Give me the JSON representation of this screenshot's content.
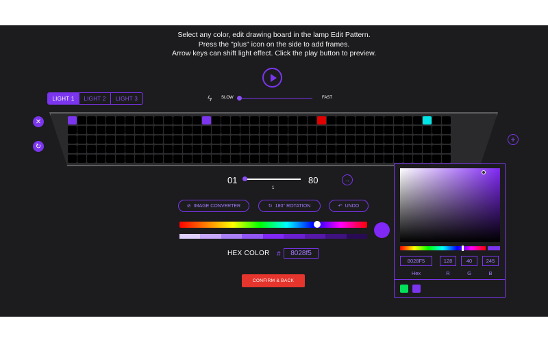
{
  "instructions": {
    "line1": "Select any color, edit drawing board in the lamp Edit Pattern.",
    "line2": "Press the \"plus\" icon on the side to add frames.",
    "line3": "Arrow keys can shift light effect. Click the play button to preview."
  },
  "tabs": [
    {
      "label": "LIGHT 1",
      "active": true
    },
    {
      "label": "LIGHT 2",
      "active": false
    },
    {
      "label": "LIGHT 3",
      "active": false
    }
  ],
  "speed": {
    "slow_label": "SLOW",
    "fast_label": "FAST",
    "value": 0
  },
  "board": {
    "rows": 5,
    "cols": 40,
    "lit": [
      {
        "row": 0,
        "col": 0,
        "color": "#7b35ee"
      },
      {
        "row": 0,
        "col": 14,
        "color": "#7b35ee"
      },
      {
        "row": 0,
        "col": 26,
        "color": "#e00000"
      },
      {
        "row": 0,
        "col": 37,
        "color": "#00e5e5"
      }
    ]
  },
  "frames": {
    "start": "01",
    "end": "80",
    "current": "1"
  },
  "actions": {
    "image_converter": "IMAGE CONVERTER",
    "rotation": "180° ROTATION",
    "undo": "UNDO"
  },
  "color": {
    "hex_label": "HEX COLOR",
    "hash": "#",
    "hex_value": "8028f5",
    "shades": [
      "#e0d0fd",
      "#c7a8fb",
      "#ac80f9",
      "#9257f7",
      "#8028f5",
      "#6a1fd1",
      "#5518a8",
      "#3f1280",
      "#290b55"
    ]
  },
  "confirm_label": "CONFIRM & BACK",
  "picker": {
    "hex": "8028F5",
    "r": "128",
    "g": "40",
    "b": "245",
    "labels": {
      "hex": "Hex",
      "r": "R",
      "g": "G",
      "b": "B"
    },
    "swatches": [
      "#00e05a",
      "#7b35ee"
    ]
  },
  "colors": {
    "accent": "#7b35ee",
    "background": "#1c1c1e",
    "confirm": "#e5352d"
  }
}
